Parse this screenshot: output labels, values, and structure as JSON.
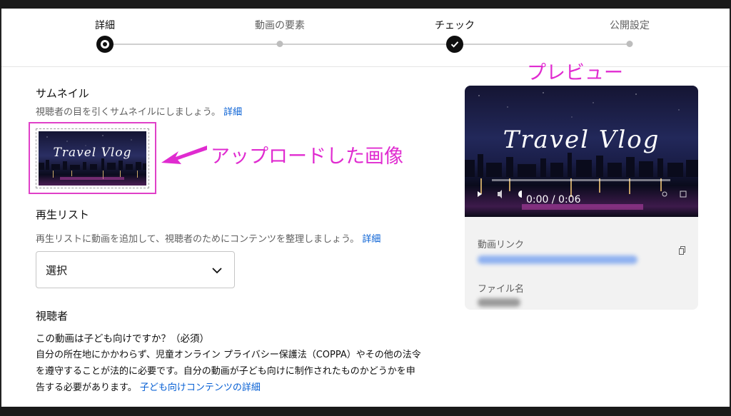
{
  "stepper": {
    "steps": [
      {
        "label": "詳細",
        "state": "current"
      },
      {
        "label": "動画の要素",
        "state": "pending"
      },
      {
        "label": "チェック",
        "state": "done"
      },
      {
        "label": "公開設定",
        "state": "pending"
      }
    ]
  },
  "thumbnail": {
    "title": "サムネイル",
    "description": "視聴者の目を引くサムネイルにしましょう。",
    "link": "詳細",
    "image_text": "Travel Vlog"
  },
  "playlist": {
    "title": "再生リスト",
    "description": "再生リストに動画を追加して、視聴者のためにコンテンツを整理しましょう。",
    "link": "詳細",
    "select_value": "選択"
  },
  "audience": {
    "title": "視聴者",
    "question": "この動画は子ども向けですか？（必須）",
    "body_line1": "自分の所在地にかかわらず、児童オンライン プライバシー保護法（COPPA）やその他の法令",
    "body_line2": "を遵守することが法的に必要です。自分の動画が子ども向けに制作されたものかどうかを申",
    "body_line3": "告する必要があります。",
    "link": "子ども向けコンテンツの詳細"
  },
  "annotations": {
    "preview": "プレビュー",
    "uploaded": "アップロードした画像"
  },
  "preview": {
    "video_text": "Travel Vlog",
    "time": "0:00 / 0:06",
    "link_label": "動画リンク",
    "file_label": "ファイル名"
  },
  "colors": {
    "accent": "#065fd4",
    "annotation": "#e02bd0"
  }
}
